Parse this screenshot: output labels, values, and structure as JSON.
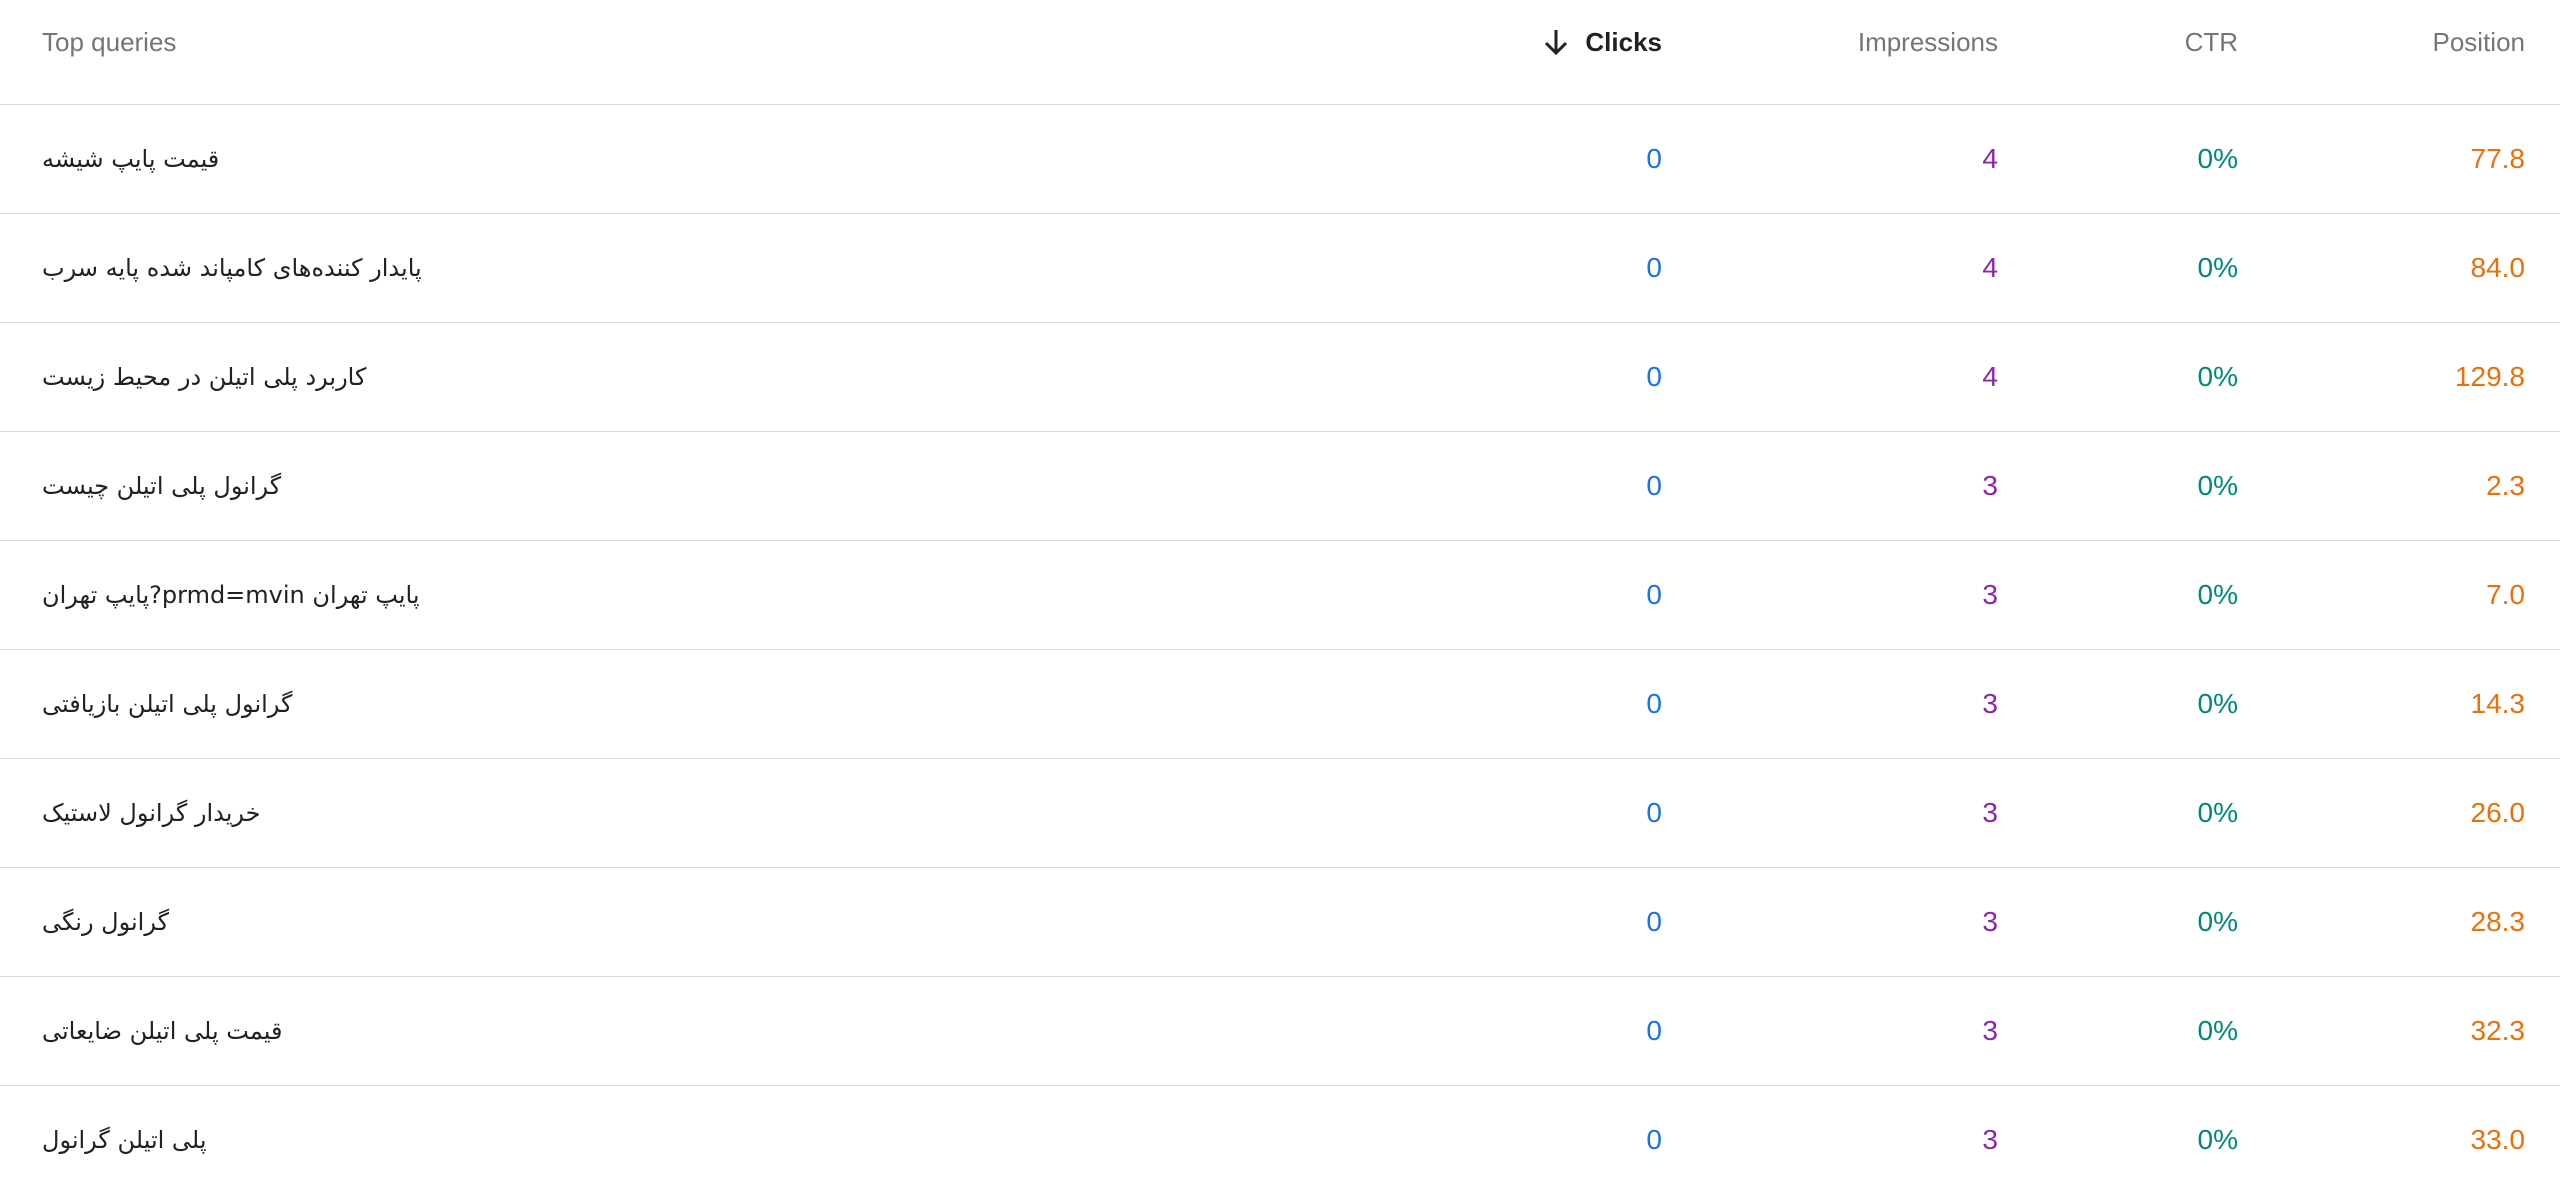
{
  "table": {
    "headers": {
      "query": "Top queries",
      "clicks": "Clicks",
      "impressions": "Impressions",
      "ctr": "CTR",
      "position": "Position"
    },
    "sort": {
      "column": "clicks",
      "direction": "descending",
      "icon": "arrow-down-icon"
    },
    "colors": {
      "clicks": "#1a73e8",
      "impressions": "#8e24aa",
      "ctr": "#00897b",
      "position": "#e8710a"
    },
    "rows": [
      {
        "query": "قیمت پایپ شیشه",
        "clicks": "0",
        "impressions": "4",
        "ctr": "0%",
        "position": "77.8"
      },
      {
        "query": "پایدار کننده‌های کامپاند شده پایه سرب",
        "clicks": "0",
        "impressions": "4",
        "ctr": "0%",
        "position": "84.0"
      },
      {
        "query": "کاربرد پلی اتیلن در محیط زیست",
        "clicks": "0",
        "impressions": "4",
        "ctr": "0%",
        "position": "129.8"
      },
      {
        "query": "گرانول پلی اتیلن چیست",
        "clicks": "0",
        "impressions": "3",
        "ctr": "0%",
        "position": "2.3"
      },
      {
        "query": "پایپ تهران prmd=mvin?پایپ تهران",
        "clicks": "0",
        "impressions": "3",
        "ctr": "0%",
        "position": "7.0"
      },
      {
        "query": "گرانول پلی اتیلن بازیافتی",
        "clicks": "0",
        "impressions": "3",
        "ctr": "0%",
        "position": "14.3"
      },
      {
        "query": "خریدار گرانول لاستیک",
        "clicks": "0",
        "impressions": "3",
        "ctr": "0%",
        "position": "26.0"
      },
      {
        "query": "گرانول رنگی",
        "clicks": "0",
        "impressions": "3",
        "ctr": "0%",
        "position": "28.3"
      },
      {
        "query": "قیمت پلی اتیلن ضایعاتی",
        "clicks": "0",
        "impressions": "3",
        "ctr": "0%",
        "position": "32.3"
      },
      {
        "query": "پلی اتیلن گرانول",
        "clicks": "0",
        "impressions": "3",
        "ctr": "0%",
        "position": "33.0"
      }
    ]
  }
}
